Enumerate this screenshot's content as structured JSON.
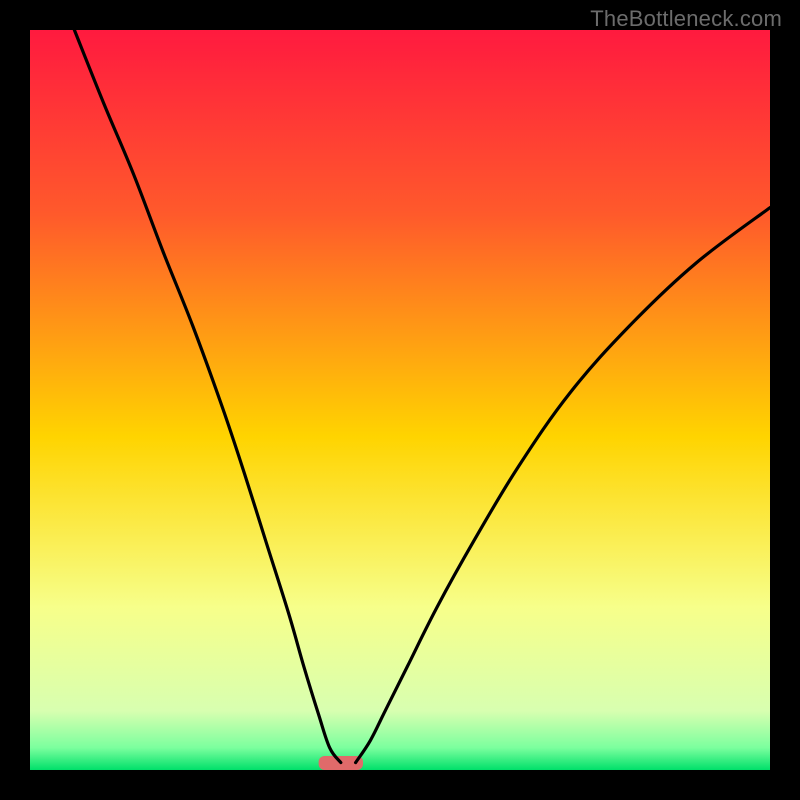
{
  "watermark": "TheBottleneck.com",
  "chart_data": {
    "type": "line",
    "title": "",
    "xlabel": "",
    "ylabel": "",
    "xlim": [
      0,
      100
    ],
    "ylim": [
      0,
      100
    ],
    "gradient_stops": [
      {
        "offset": 0,
        "color": "#ff1a3f"
      },
      {
        "offset": 25,
        "color": "#ff5a2b"
      },
      {
        "offset": 55,
        "color": "#ffd400"
      },
      {
        "offset": 78,
        "color": "#f7ff8a"
      },
      {
        "offset": 92,
        "color": "#d8ffb0"
      },
      {
        "offset": 97,
        "color": "#7bff9e"
      },
      {
        "offset": 100,
        "color": "#00e06a"
      }
    ],
    "marker": {
      "x": 42,
      "width": 6,
      "color": "#e06a6a"
    },
    "series": [
      {
        "name": "left-branch",
        "x": [
          6,
          10,
          14,
          18,
          22,
          26,
          29,
          32,
          35,
          37,
          39,
          40.5,
          42
        ],
        "y": [
          100,
          90,
          80.5,
          70,
          60,
          49,
          40,
          30.5,
          21,
          14,
          7.5,
          3,
          1
        ]
      },
      {
        "name": "right-branch",
        "x": [
          44,
          46,
          48,
          51,
          55,
          60,
          66,
          73,
          81,
          90,
          100
        ],
        "y": [
          1,
          4,
          8,
          14,
          22,
          31,
          41,
          51,
          60,
          68.5,
          76
        ]
      }
    ]
  }
}
